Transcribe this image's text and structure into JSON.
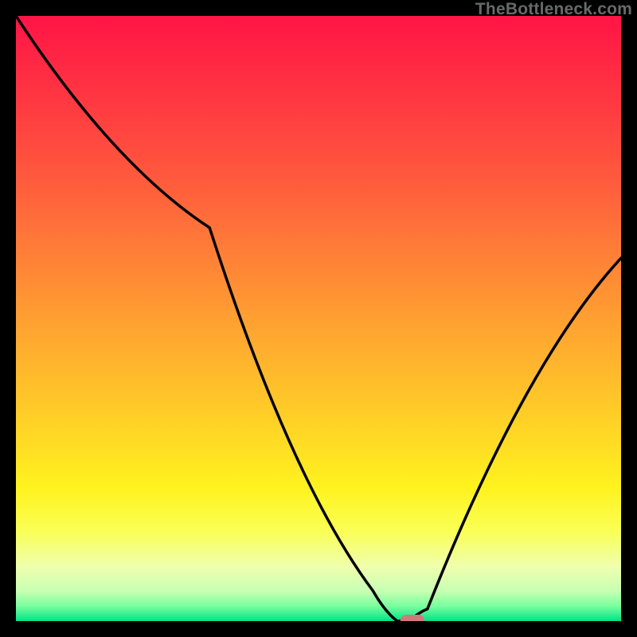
{
  "watermark": "TheBottleneck.com",
  "chart_data": {
    "type": "line",
    "title": "",
    "xlabel": "",
    "ylabel": "",
    "xlim": [
      0,
      100
    ],
    "ylim": [
      0,
      100
    ],
    "grid": false,
    "series": [
      {
        "name": "bottleneck-curve",
        "x": [
          0,
          32,
          59,
          63,
          65,
          68,
          100
        ],
        "y": [
          100,
          65,
          5,
          0,
          0,
          2,
          60
        ]
      }
    ],
    "marker": {
      "x": 65.5,
      "y": 0,
      "color": "#cf7a7a"
    },
    "background_gradient_stops": [
      {
        "offset": 0.0,
        "color": "#ff1446"
      },
      {
        "offset": 0.09,
        "color": "#ff2b43"
      },
      {
        "offset": 0.18,
        "color": "#ff4240"
      },
      {
        "offset": 0.27,
        "color": "#ff5a3d"
      },
      {
        "offset": 0.36,
        "color": "#ff7539"
      },
      {
        "offset": 0.45,
        "color": "#ff9034"
      },
      {
        "offset": 0.54,
        "color": "#ffab2f"
      },
      {
        "offset": 0.63,
        "color": "#ffc529"
      },
      {
        "offset": 0.72,
        "color": "#ffe023"
      },
      {
        "offset": 0.78,
        "color": "#fff31e"
      },
      {
        "offset": 0.85,
        "color": "#faff54"
      },
      {
        "offset": 0.91,
        "color": "#efffad"
      },
      {
        "offset": 0.95,
        "color": "#c8ffb3"
      },
      {
        "offset": 0.975,
        "color": "#7aff9e"
      },
      {
        "offset": 1.0,
        "color": "#00e388"
      }
    ]
  }
}
